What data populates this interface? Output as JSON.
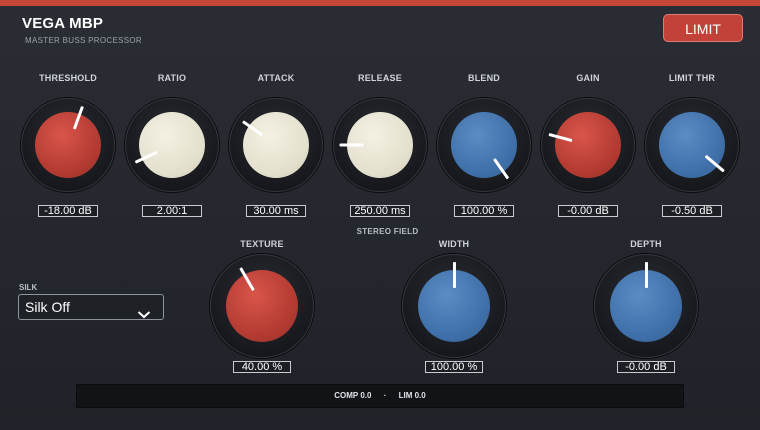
{
  "header": {
    "title": "VEGA MBP",
    "subtitle": "MASTER BUSS PROCESSOR",
    "limit_label": "LIMIT"
  },
  "colors": {
    "accent_red": "#c2423a",
    "knob_red": "#c0453a",
    "knob_cream": "#e9e6d6",
    "knob_blue": "#4677b0"
  },
  "knobs_row1": [
    {
      "label": "THRESHOLD",
      "value": "-18.00 dB",
      "style": "red",
      "angle": 20
    },
    {
      "label": "RATIO",
      "value": "2.00:1",
      "style": "cream",
      "angle": -115
    },
    {
      "label": "ATTACK",
      "value": "30.00 ms",
      "style": "cream",
      "angle": -55
    },
    {
      "label": "RELEASE",
      "value": "250.00 ms",
      "style": "cream",
      "angle": -90
    },
    {
      "label": "BLEND",
      "value": "100.00 %",
      "style": "blue",
      "angle": 145
    },
    {
      "label": "GAIN",
      "value": "-0.00 dB",
      "style": "red",
      "angle": -75
    },
    {
      "label": "LIMIT THR",
      "value": "-0.50 dB",
      "style": "blue",
      "angle": 130
    }
  ],
  "section": {
    "stereo_field": "STEREO FIELD"
  },
  "knobs_row2": [
    {
      "label": "TEXTURE",
      "value": "40.00 %",
      "style": "red",
      "angle": -30
    },
    {
      "label": "WIDTH",
      "value": "100.00 %",
      "style": "blue",
      "angle": 0
    },
    {
      "label": "DEPTH",
      "value": "-0.00 dB",
      "style": "blue",
      "angle": 0
    }
  ],
  "silk": {
    "label": "SILK",
    "selected": "Silk Off"
  },
  "status": {
    "comp": "COMP 0.0",
    "separator": "·",
    "lim": "LIM 0.0"
  }
}
